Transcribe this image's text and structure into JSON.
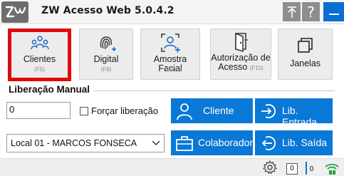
{
  "window": {
    "title": "ZW Acesso Web 5.0.4.2",
    "help_label": "?"
  },
  "tiles": [
    {
      "label": "Clientes",
      "key": "(F5)"
    },
    {
      "label": "Digital",
      "key": "(F8)"
    },
    {
      "label": "Amostra Facial",
      "key": "(F9)"
    },
    {
      "label": "Autorização de Acesso",
      "key": "(F10)"
    },
    {
      "label": "Janelas",
      "key": ""
    }
  ],
  "liberacao": {
    "section_title": "Liberação Manual",
    "code_value": "0",
    "force_label": "Forçar liberação",
    "force_checked": false,
    "local_selected": "Local 01 - MARCOS FONSECA"
  },
  "actions": {
    "cliente": "Cliente",
    "lib_entrada": "Lib. Entrada",
    "colaborador": "Colaborador",
    "lib_saida": "Lib. Saída"
  },
  "status": {
    "counter_1": "0",
    "counter_2": "0"
  },
  "colors": {
    "accent_blue": "#0a78d6",
    "highlight_red": "#e00a0a",
    "network_green": "#1ea64a"
  },
  "icons": [
    "app-logo-icon",
    "pin-icon",
    "minimize-icon",
    "clients-icon",
    "fingerprint-icon",
    "face-scan-icon",
    "authorization-icon",
    "windows-icon",
    "person-icon",
    "entry-icon",
    "briefcase-icon",
    "exit-icon",
    "gear-icon",
    "network-icon"
  ]
}
